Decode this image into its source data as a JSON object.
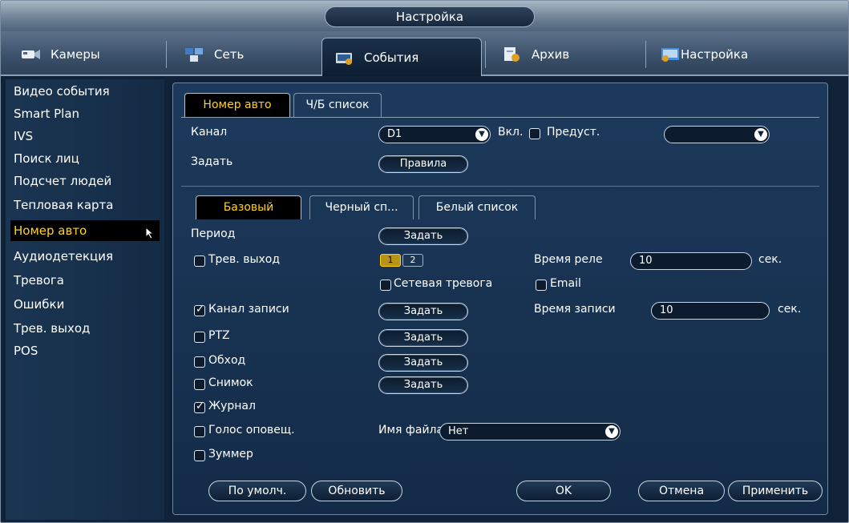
{
  "window": {
    "title": "Настройка"
  },
  "tabs": [
    {
      "label": "Камеры",
      "icon": "camera-icon"
    },
    {
      "label": "Сеть",
      "icon": "network-icon"
    },
    {
      "label": "События",
      "icon": "events-icon",
      "active": true
    },
    {
      "label": "Архив",
      "icon": "archive-icon"
    },
    {
      "label": "Настройка",
      "icon": "settings-icon"
    }
  ],
  "sidebar": {
    "items": [
      "Видео события",
      "Smart Plan",
      "IVS",
      "Поиск лиц",
      "Подсчет людей",
      "Тепловая карта",
      "Номер авто",
      "Аудиодетекция",
      "Тревога",
      "Ошибки",
      "Трев. выход",
      "POS"
    ],
    "selected_index": 6
  },
  "subtabs": {
    "plate": "Номер авто",
    "bw_list": "Ч/Б список"
  },
  "channel": {
    "label": "Канал",
    "value": "D1",
    "enable_label": "Вкл.",
    "preset_label": "Предуст.",
    "preset_value": ""
  },
  "rules": {
    "label": "Задать",
    "button": "Правила"
  },
  "list_tabs": {
    "basic": "Базовый",
    "black": "Черный сп...",
    "white": "Белый список"
  },
  "period": {
    "label": "Период",
    "button": "Задать"
  },
  "alarm_out": {
    "label": "Трев. выход",
    "ch1": "1",
    "ch2": "2",
    "relay_label": "Время реле",
    "relay_value": "10",
    "unit": "сек."
  },
  "network_alarm": {
    "label": "Сетевая тревога"
  },
  "email": {
    "label": "Email"
  },
  "record_channel": {
    "label": "Канал записи",
    "button": "Задать",
    "time_label": "Время записи",
    "time_value": "10",
    "unit": "сек."
  },
  "ptz": {
    "label": "PTZ",
    "button": "Задать"
  },
  "tour": {
    "label": "Обход",
    "button": "Задать"
  },
  "snapshot": {
    "label": "Снимок",
    "button": "Задать"
  },
  "log": {
    "label": "Журнал"
  },
  "voice": {
    "label": "Голос оповещ.",
    "file_label": "Имя файла",
    "file_value": "Нет"
  },
  "buzzer": {
    "label": "Зуммер"
  },
  "buttons": {
    "default": "По умолч.",
    "refresh": "Обновить",
    "ok": "OK",
    "cancel": "Отмена",
    "apply": "Применить"
  },
  "colors": {
    "accent": "#ffd21f",
    "panel": "#1d3a5c",
    "background": "#0f2238"
  }
}
